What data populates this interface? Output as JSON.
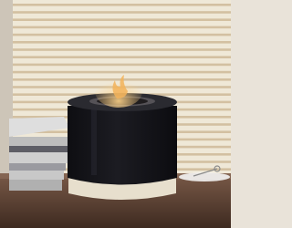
{
  "image": {
    "kind": "photograph",
    "subjects": [
      "tabletop-fireplace",
      "window-blinds",
      "stacked-books",
      "snuffer-tool",
      "wooden-desk"
    ]
  },
  "palette": {
    "blind_light": "#f1ead8",
    "blind_dark": "#c9b38f",
    "wall": "#d6cec2",
    "fireplace_body": "#15151a",
    "fireplace_base": "#e9e1d0",
    "flame": "#f2b35a",
    "desk": "#5a4032",
    "books": "#cfcfcf"
  }
}
